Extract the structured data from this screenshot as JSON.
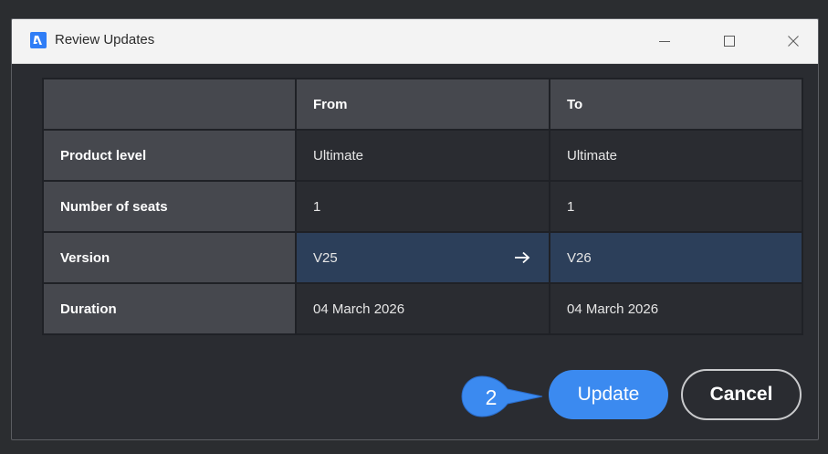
{
  "window": {
    "title": "Review Updates"
  },
  "table": {
    "headers": [
      "",
      "From",
      "To"
    ],
    "rows": [
      {
        "label": "Product level",
        "from": "Ultimate",
        "to": "Ultimate"
      },
      {
        "label": "Number of seats",
        "from": "1",
        "to": "1"
      },
      {
        "label": "Version",
        "from": "V25",
        "to": "V26",
        "highlighted": true
      },
      {
        "label": "Duration",
        "from": "04 March 2026",
        "to": "04 March 2026"
      }
    ]
  },
  "step_badge": {
    "number": "2"
  },
  "buttons": {
    "update_label": "Update",
    "cancel_label": "Cancel"
  },
  "colors": {
    "accent": "#3b8af0",
    "highlight_row": "#2c3f5a",
    "header_cell": "#46484e",
    "background": "#2a2c31"
  },
  "icons": {
    "app": "app-logo-icon",
    "minimize": "minimize-icon",
    "maximize": "maximize-icon",
    "close": "close-icon",
    "arrow": "arrow-right-icon"
  }
}
